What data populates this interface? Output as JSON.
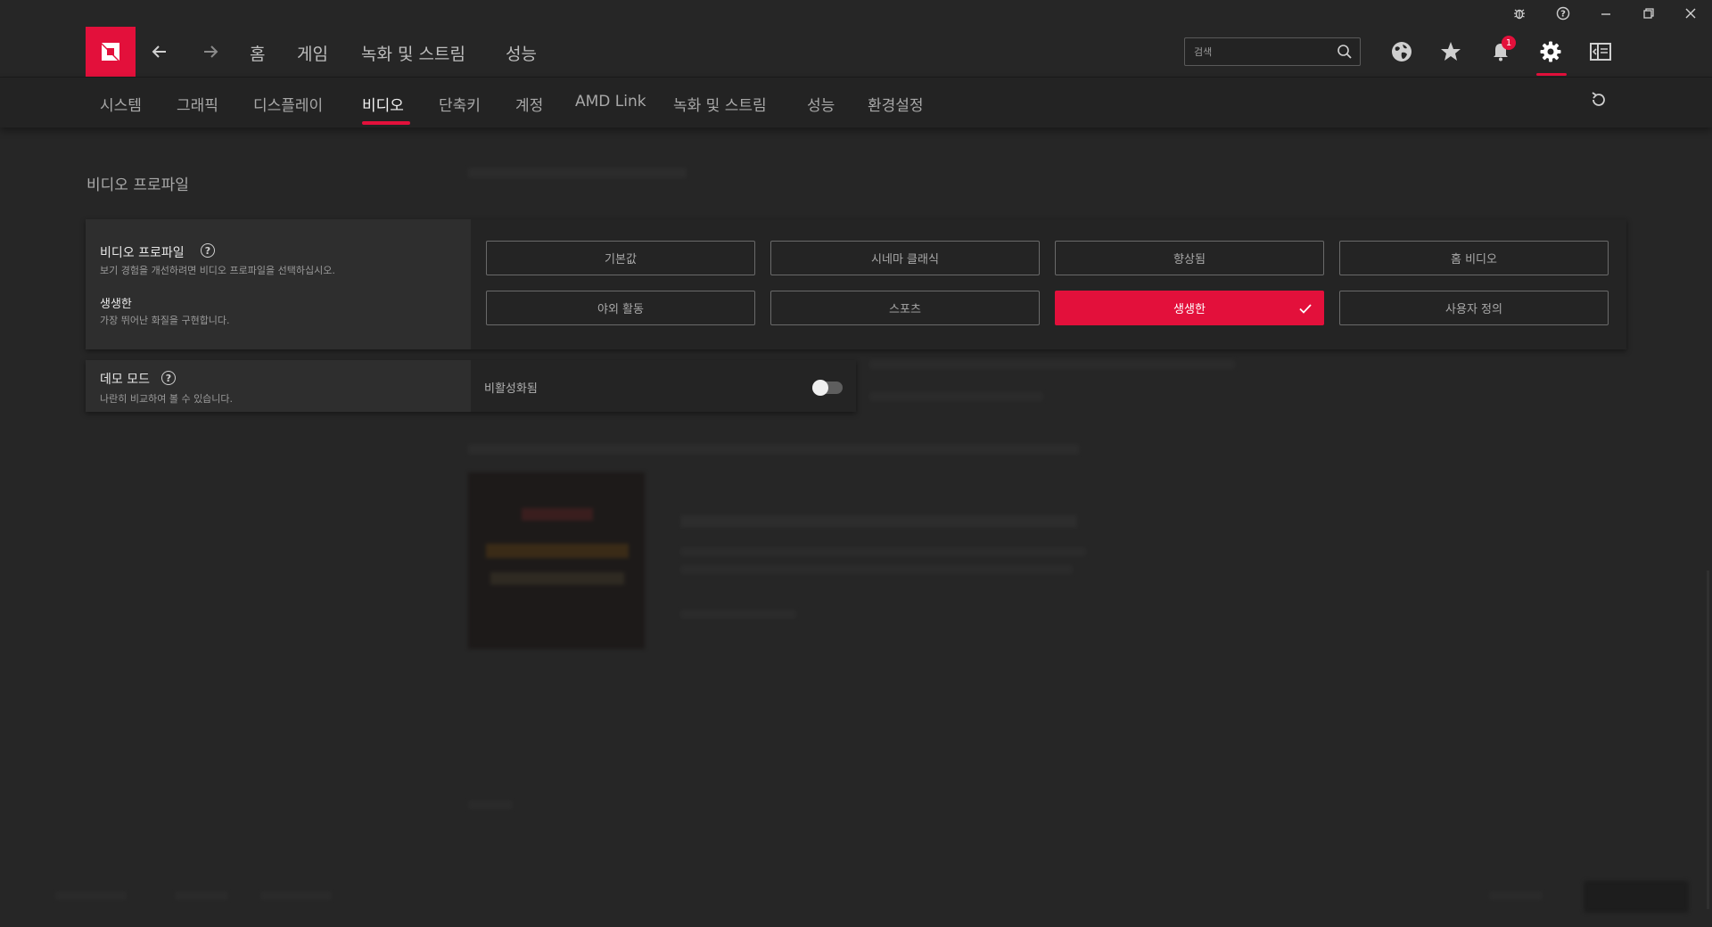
{
  "titlebar": {
    "icons": [
      "bug-icon",
      "help-circle-icon",
      "minimize-icon",
      "restore-icon",
      "close-icon"
    ]
  },
  "topnav": {
    "logo": "amd-logo",
    "items": [
      "홈",
      "게임",
      "녹화 및 스트림",
      "성능"
    ],
    "search_placeholder": "검색",
    "notification_count": "1",
    "icons": [
      "globe-icon",
      "star-icon",
      "bell-icon",
      "gear-icon",
      "sidebar-panel-icon"
    ]
  },
  "subnav": {
    "items": [
      "시스템",
      "그래픽",
      "디스플레이",
      "비디오",
      "단축키",
      "계정",
      "AMD Link",
      "녹화 및 스트림",
      "성능",
      "환경설정"
    ],
    "active": "비디오"
  },
  "page": {
    "title": "비디오 프로파일"
  },
  "video_profile": {
    "title": "비디오 프로파일",
    "description": "보기 경험을 개선하려면 비디오 프로파일을 선택하십시오.",
    "selected_title": "생생한",
    "selected_description": "가장 뛰어난 화질을 구현합니다.",
    "options": [
      "기본값",
      "시네마 클래식",
      "향상됨",
      "홈 비디오",
      "야외 활동",
      "스포츠",
      "생생한",
      "사용자 정의"
    ],
    "selected": "생생한"
  },
  "demo_mode": {
    "title": "데모 모드",
    "description": "나란히 비교하여 볼 수 있습니다.",
    "value_label": "비활성화됨",
    "enabled": false
  },
  "colors": {
    "accent": "#e3103b",
    "background": "#262626",
    "card": "#2a2a2a"
  }
}
